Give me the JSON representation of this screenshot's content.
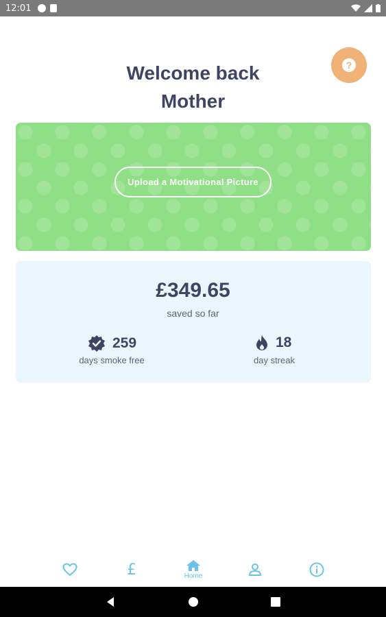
{
  "status_bar": {
    "time": "12:01"
  },
  "header": {
    "title_line1": "Welcome back",
    "title_line2": "Mother",
    "help_icon": "question-icon"
  },
  "hero": {
    "upload_label": "Upload a Motivational Picture",
    "color": "#8fdf86"
  },
  "stats": {
    "saved_amount": "£349.65",
    "saved_label": "saved so far",
    "smoke_free_value": "259",
    "smoke_free_label": "days smoke free",
    "streak_value": "18",
    "streak_label": "day streak"
  },
  "nav": {
    "items": [
      {
        "icon": "heart-icon"
      },
      {
        "icon": "pound-icon",
        "glyph": "£"
      },
      {
        "icon": "home-icon",
        "label": "Home",
        "active": true
      },
      {
        "icon": "profile-icon"
      },
      {
        "icon": "info-icon"
      }
    ]
  },
  "colors": {
    "accent": "#6bc2ea",
    "text": "#3d4563",
    "help": "#f0b277",
    "card": "#eaf6fd"
  }
}
